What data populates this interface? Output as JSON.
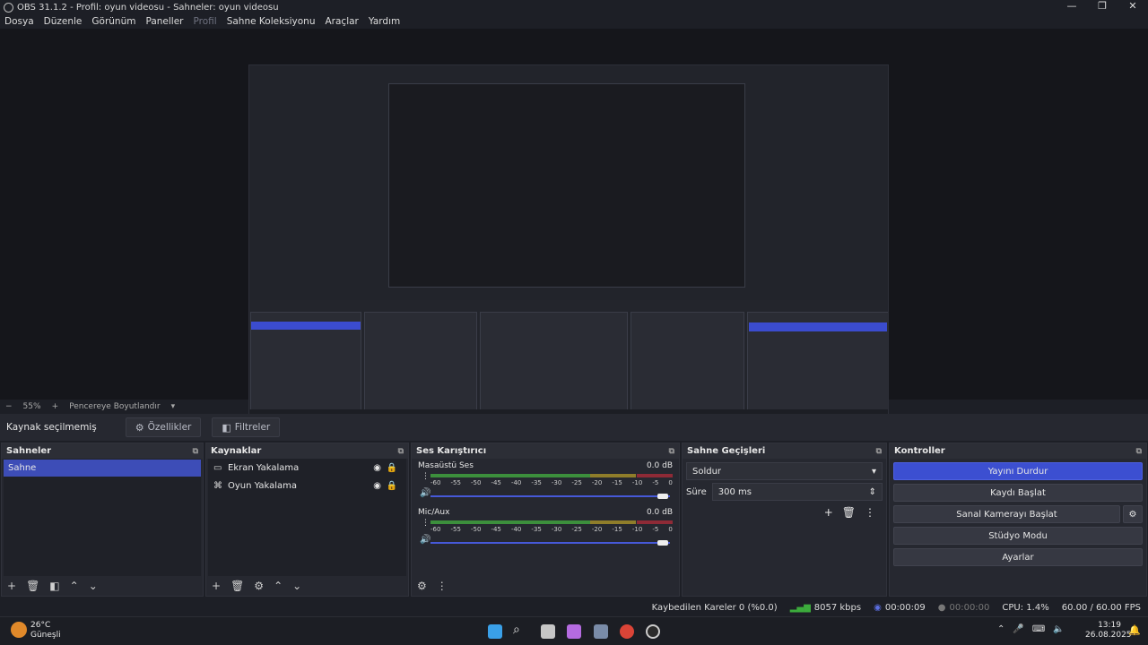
{
  "window": {
    "title": "OBS 31.1.2 - Profil: oyun videosu - Sahneler: oyun videosu",
    "controls": {
      "minimize": "—",
      "restore": "❐",
      "close": "✕"
    }
  },
  "menu": {
    "items": [
      "Dosya",
      "Düzenle",
      "Görünüm",
      "Paneller",
      "Profil",
      "Sahne Koleksiyonu",
      "Araçlar",
      "Yardım"
    ]
  },
  "zoom": {
    "minus": "−",
    "value": "55%",
    "plus": "+",
    "mode": "Pencereye Boyutlandır",
    "caret": "▾"
  },
  "source_toolbar": {
    "label": "Kaynak seçilmemiş",
    "properties": "Özellikler",
    "filters": "Filtreler"
  },
  "scenes": {
    "title": "Sahneler",
    "items": [
      "Sahne"
    ]
  },
  "sources": {
    "title": "Kaynaklar",
    "items": [
      {
        "name": "Ekran Yakalama",
        "icon": "monitor-icon"
      },
      {
        "name": "Oyun Yakalama",
        "icon": "gamepad-icon"
      }
    ]
  },
  "mixer": {
    "title": "Ses Karıştırıcı",
    "channels": [
      {
        "name": "Masaüstü Ses",
        "db": "0.0 dB",
        "volume": 1.0
      },
      {
        "name": "Mic/Aux",
        "db": "0.0 dB",
        "volume": 1.0
      }
    ],
    "ticks": [
      "-60",
      "-55",
      "-50",
      "-45",
      "-40",
      "-35",
      "-30",
      "-25",
      "-20",
      "-15",
      "-10",
      "-5",
      "0"
    ]
  },
  "transitions": {
    "title": "Sahne Geçişleri",
    "selected": "Soldur",
    "duration_label": "Süre",
    "duration_value": "300 ms"
  },
  "controls": {
    "title": "Kontroller",
    "buttons": [
      "Yayını Durdur",
      "Kaydı Başlat",
      "Sanal Kamerayı Başlat",
      "Stüdyo Modu",
      "Ayarlar"
    ]
  },
  "status": {
    "dropped": "Kaybedilen Kareler 0 (%0.0)",
    "bitrate": "8057 kbps",
    "stream_time": "00:00:09",
    "rec_time": "00:00:00",
    "cpu": "CPU: 1.4%",
    "fps": "60.00 / 60.00 FPS"
  },
  "taskbar": {
    "weather_temp": "26°C",
    "weather_desc": "Güneşli",
    "time": "13:19",
    "date": "26.08.2025"
  },
  "colors": {
    "accent": "#3c4fd1",
    "meter_green": "#3c8f3c",
    "meter_yellow": "#8f7d2a",
    "meter_red": "#8e2a36"
  }
}
